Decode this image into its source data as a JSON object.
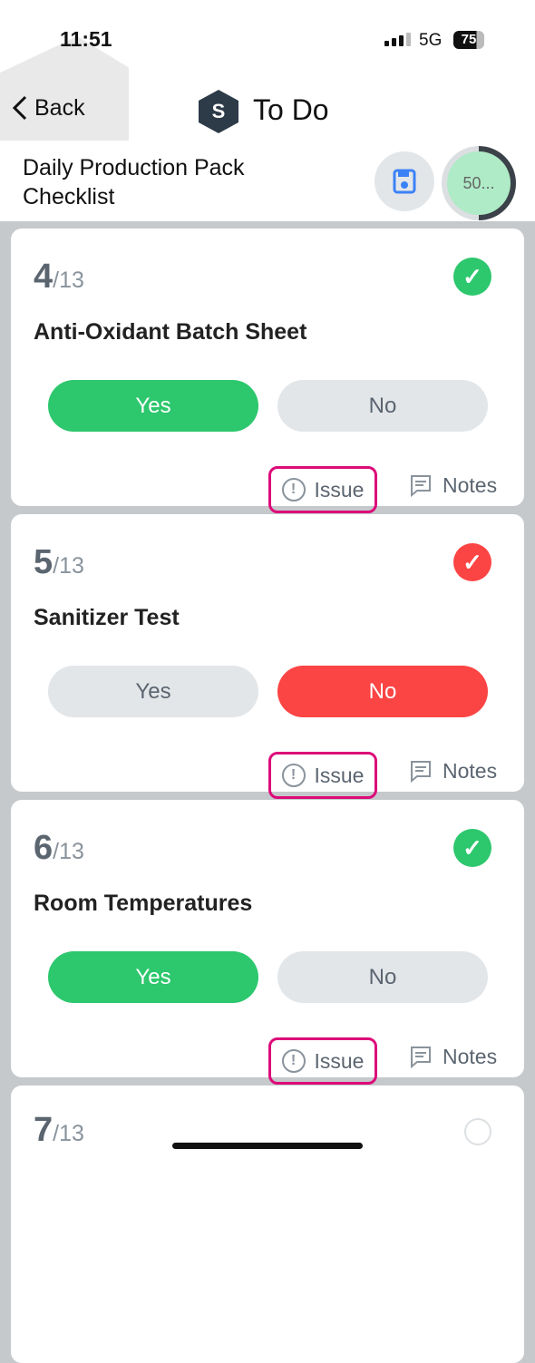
{
  "status_bar": {
    "time": "11:51",
    "network": "5G",
    "battery": "75"
  },
  "nav": {
    "back_label": "Back",
    "title": "To Do",
    "logo_text": "S"
  },
  "checklist": {
    "title": "Daily Production Pack Checklist",
    "progress_label": "50...",
    "progress_percent": 50
  },
  "items": [
    {
      "number": "4",
      "total": "/13",
      "question": "Anti-Oxidant Batch Sheet",
      "yes": "Yes",
      "no": "No",
      "answer": "yes",
      "status": "complete-green",
      "issue": "Issue",
      "notes": "Notes"
    },
    {
      "number": "5",
      "total": "/13",
      "question": "Sanitizer Test",
      "yes": "Yes",
      "no": "No",
      "answer": "no",
      "status": "complete-red",
      "issue": "Issue",
      "notes": "Notes"
    },
    {
      "number": "6",
      "total": "/13",
      "question": "Room Temperatures",
      "yes": "Yes",
      "no": "No",
      "answer": "yes",
      "status": "complete-green",
      "issue": "Issue",
      "notes": "Notes"
    },
    {
      "number": "7",
      "total": "/13",
      "status": "incomplete"
    }
  ],
  "colors": {
    "yes": "#2dc76d",
    "no": "#fb4444",
    "highlight": "#dd0a79",
    "accent": "#3b82f6"
  }
}
